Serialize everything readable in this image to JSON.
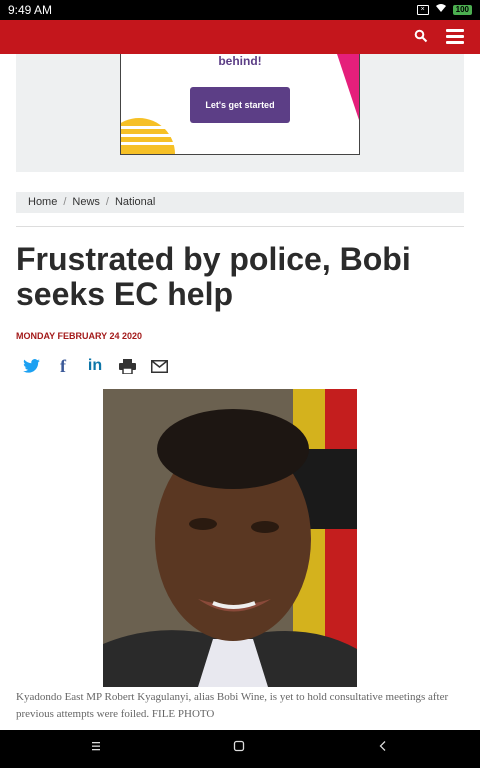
{
  "status_bar": {
    "time": "9:49 AM",
    "battery": "100"
  },
  "top_nav": {
    "search_icon": "search-icon",
    "menu_icon": "hamburger-menu-icon",
    "background": "#c4161c"
  },
  "ad": {
    "headline": "behind!",
    "cta_label": "Let's get started",
    "accent": "#5c3e86"
  },
  "breadcrumb": {
    "items": [
      "Home",
      "News",
      "National"
    ],
    "separator": "/"
  },
  "article": {
    "headline": "Frustrated by police, Bobi seeks EC help",
    "date": "MONDAY FEBRUARY 24 2020",
    "share": {
      "twitter": "twitter-icon",
      "facebook": "facebook-icon",
      "linkedin": "in",
      "print": "print-icon",
      "email": "email-icon"
    },
    "photo_caption": "Kyadondo East MP Robert Kyagulanyi, alias Bobi Wine, is yet to hold consultative meetings after previous attempts were foiled. FILE PHOTO"
  },
  "system_nav": {
    "menu": "menu-icon",
    "home": "home-icon",
    "back": "back-icon"
  }
}
